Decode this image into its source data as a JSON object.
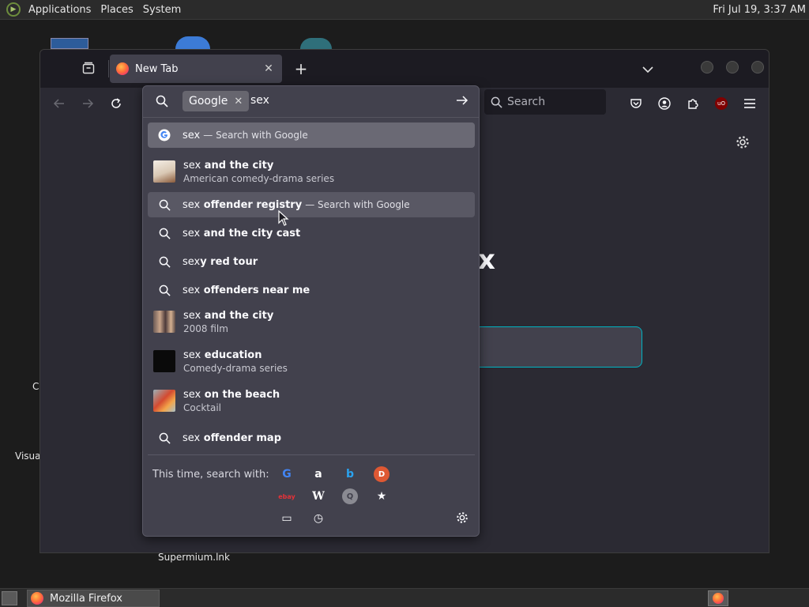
{
  "top_panel": {
    "menus": [
      "Applications",
      "Places",
      "System"
    ],
    "clock": "Fri Jul 19,  3:37 AM"
  },
  "desktop": {
    "labels": [
      "C",
      "Visua",
      "Supermium.lnk"
    ]
  },
  "browser": {
    "tab": {
      "title": "New Tab"
    },
    "search_box_placeholder": "Search",
    "page_logo_fragment": "x"
  },
  "urlbar": {
    "engine_chip": "Google",
    "typed_text": "sex"
  },
  "results": [
    {
      "typed": "sex",
      "suffix": "",
      "action": "— Search with Google",
      "sub": "",
      "icon": "google-icon",
      "state": "selected"
    },
    {
      "typed": "sex",
      "suffix": " and the city",
      "action": "",
      "sub": "American comedy-drama series",
      "icon": "thumbnail-tv-series",
      "state": ""
    },
    {
      "typed": "sex",
      "suffix": " offender registry",
      "action": "— Search with Google",
      "sub": "",
      "icon": "search-icon",
      "state": "hovered"
    },
    {
      "typed": "sex",
      "suffix": " and the city cast",
      "action": "",
      "sub": "",
      "icon": "search-icon",
      "state": ""
    },
    {
      "typed": "sex",
      "suffix": "y red tour",
      "action": "",
      "sub": "",
      "icon": "search-icon",
      "state": ""
    },
    {
      "typed": "sex",
      "suffix": " offenders near me",
      "action": "",
      "sub": "",
      "icon": "search-icon",
      "state": ""
    },
    {
      "typed": "sex",
      "suffix": " and the city",
      "action": "",
      "sub": "2008 film",
      "icon": "thumbnail-film",
      "state": ""
    },
    {
      "typed": "sex",
      "suffix": " education",
      "action": "",
      "sub": "Comedy-drama series",
      "icon": "thumbnail-education",
      "state": ""
    },
    {
      "typed": "sex",
      "suffix": " on the beach",
      "action": "",
      "sub": "Cocktail",
      "icon": "thumbnail-cocktail",
      "state": ""
    },
    {
      "typed": "sex",
      "suffix": " offender map",
      "action": "",
      "sub": "",
      "icon": "search-icon",
      "state": ""
    }
  ],
  "one_off": {
    "label": "This time, search with:",
    "engines": [
      {
        "name": "google-engine-icon",
        "glyph": "G",
        "color": "#4285f4"
      },
      {
        "name": "amazon-engine-icon",
        "glyph": "a",
        "color": "#ffffff"
      },
      {
        "name": "bing-engine-icon",
        "glyph": "b",
        "color": "#2aa3ef"
      },
      {
        "name": "duckduckgo-engine-icon",
        "glyph": "D",
        "color": "#de5833"
      },
      {
        "name": "ebay-engine-icon",
        "glyph": "ebay",
        "color": "#e53238"
      },
      {
        "name": "wikipedia-engine-icon",
        "glyph": "W",
        "color": "#ffffff"
      },
      {
        "name": "qwant-engine-icon",
        "glyph": "Q",
        "color": "#9a9aa2"
      },
      {
        "name": "bookmarks-icon",
        "glyph": "★",
        "color": "#fbfbfe"
      },
      {
        "name": "tabs-icon",
        "glyph": "▭",
        "color": "#fbfbfe"
      },
      {
        "name": "history-icon",
        "glyph": "◷",
        "color": "#fbfbfe"
      }
    ]
  },
  "taskbar": {
    "window_label": "Mozilla Firefox"
  }
}
